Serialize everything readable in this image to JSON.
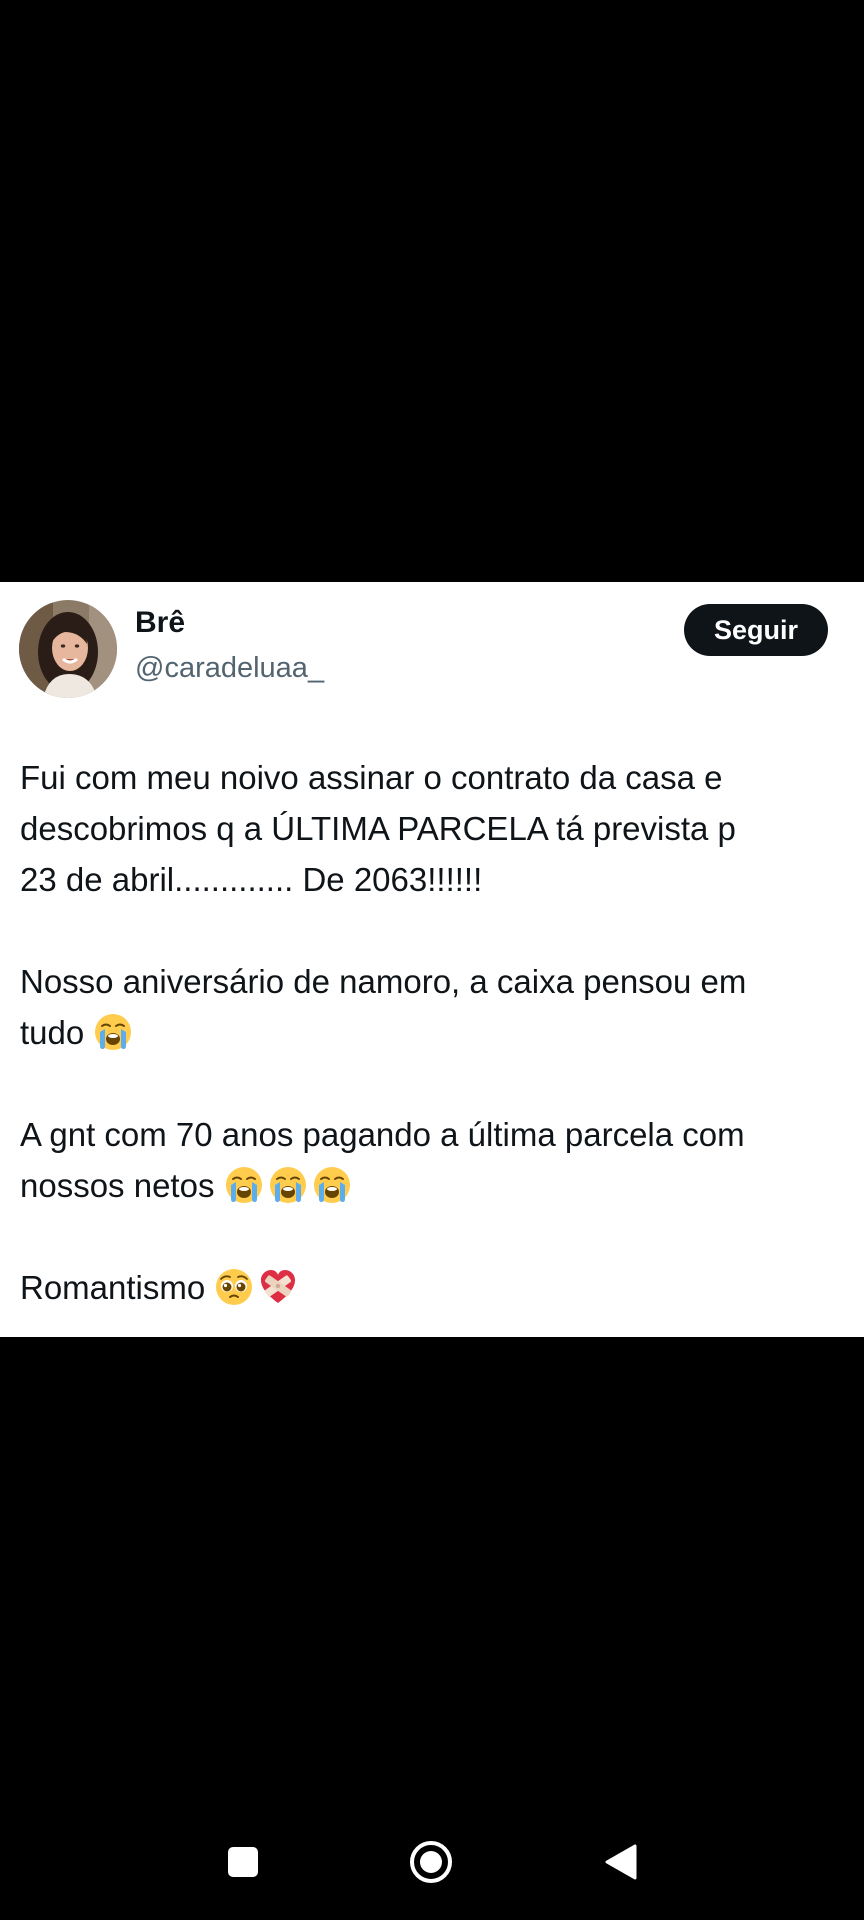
{
  "tweet": {
    "display_name": "Brê",
    "handle": "@caradeluaa_",
    "follow_label": "Seguir",
    "paragraphs": [
      {
        "lines": [
          "Fui com meu noivo assinar o contrato da casa e",
          "descobrimos q a ÚLTIMA PARCELA tá prevista p",
          "23 de abril............. De 2063!!!!!!"
        ]
      },
      {
        "lines": [
          "Nosso aniversário de namoro, a caixa pensou em",
          "tudo"
        ],
        "emoji": [
          "loudly-crying-face-icon"
        ]
      },
      {
        "lines": [
          "A gnt com 70 anos pagando a última parcela com",
          "nossos netos"
        ],
        "emoji": [
          "loudly-crying-face-icon",
          "loudly-crying-face-icon",
          "loudly-crying-face-icon"
        ]
      },
      {
        "lines": [
          "Romantismo"
        ],
        "emoji": [
          "pleading-face-icon",
          "mending-heart-icon"
        ]
      }
    ]
  },
  "nav": {
    "icons": [
      "recents-square-icon",
      "home-circle-icon",
      "back-triangle-icon"
    ]
  },
  "colors": {
    "background": "#000000",
    "card": "#ffffff",
    "text": "#0f1419",
    "handle": "#536471",
    "button": "#0f1419"
  }
}
